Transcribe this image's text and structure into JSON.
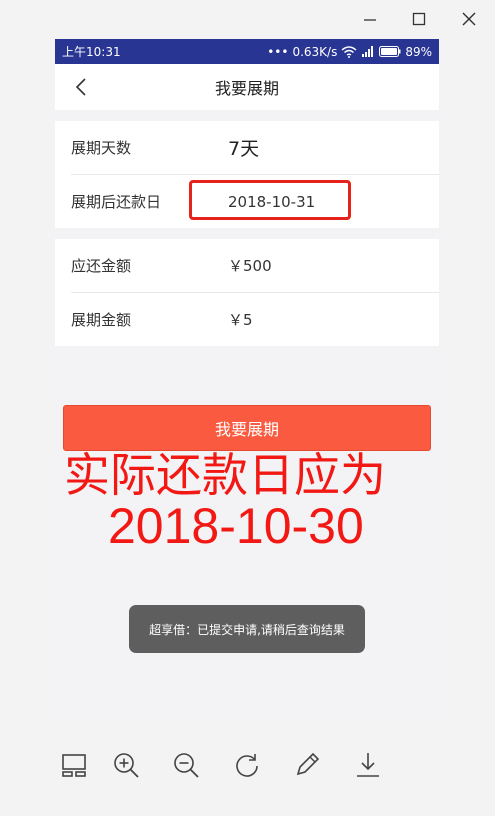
{
  "window": {
    "minimize": "minimize",
    "maximize": "maximize",
    "close": "close"
  },
  "status_bar": {
    "time": "上午10:31",
    "network_speed": "0.63K/s",
    "battery": "89%"
  },
  "navbar": {
    "title": "我要展期"
  },
  "extension_card": {
    "rows": [
      {
        "label": "展期天数",
        "value": "7天"
      },
      {
        "label": "展期后还款日",
        "value": "2018-10-31"
      }
    ]
  },
  "amount_card": {
    "rows": [
      {
        "label": "应还金额",
        "value": "￥500"
      },
      {
        "label": "展期金额",
        "value": "￥5"
      }
    ]
  },
  "submit_button": {
    "label": "我要展期"
  },
  "annotation": {
    "line1": "实际还款日应为",
    "line2": "2018-10-30"
  },
  "toast": {
    "text": "超享借：已提交申请,请稍后查询结果"
  },
  "viewer_toolbar": [
    "layout-icon",
    "zoom-in-icon",
    "zoom-out-icon",
    "rotate-icon",
    "edit-icon",
    "download-icon"
  ],
  "colors": {
    "status_bar": "#283593",
    "button": "#fa5a3f",
    "annotation": "#f21914",
    "highlight_box": "#e6231b"
  }
}
